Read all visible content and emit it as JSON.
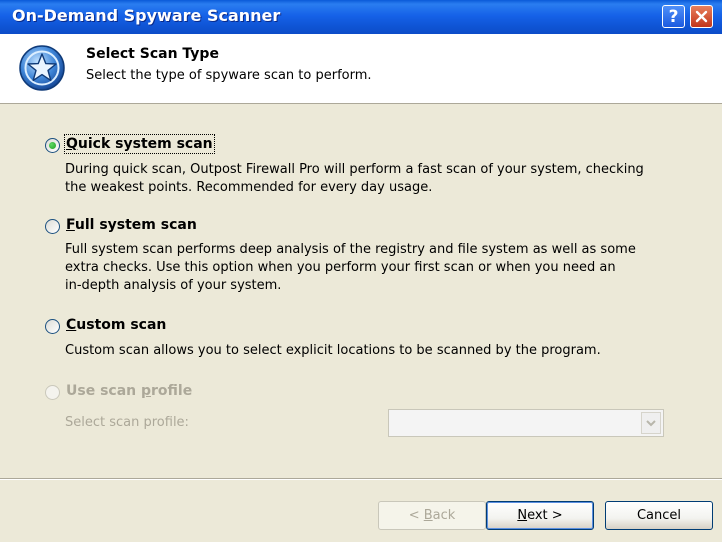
{
  "window": {
    "title": "On-Demand Spyware Scanner",
    "help_label": "?"
  },
  "header": {
    "icon": "shield-star-icon",
    "title": "Select Scan Type",
    "subtitle": "Select the type of spyware scan to perform."
  },
  "options": [
    {
      "key": "Q",
      "label_rest": "uick system scan",
      "checked": true,
      "enabled": true,
      "description_lines": [
        "During quick scan, Outpost Firewall Pro will perform a fast scan of your system, checking",
        "the weakest points. Recommended for every day usage."
      ]
    },
    {
      "key": "F",
      "label_rest": "ull system scan",
      "checked": false,
      "enabled": true,
      "description_lines": [
        "Full system scan performs deep analysis of the registry and file system as well as some",
        "extra checks. Use this option when you perform your first scan or when you need an",
        "in-depth analysis of your system."
      ]
    },
    {
      "key": "C",
      "label_rest": "ustom scan",
      "checked": false,
      "enabled": true,
      "description_lines": [
        "Custom scan allows you to select explicit locations to be scanned by the program."
      ]
    },
    {
      "label_pre": "Use scan ",
      "key": "p",
      "label_rest": "rofile",
      "checked": false,
      "enabled": false
    }
  ],
  "profile": {
    "label": "Select scan profile:",
    "value": ""
  },
  "buttons": {
    "back_arrow": "< ",
    "back_key": "B",
    "back_rest": "ack",
    "next_key": "N",
    "next_rest": "ext >",
    "cancel": "Cancel"
  },
  "colors": {
    "titlebar": "#1662e8",
    "dialog_bg": "#ece9d8",
    "disabled_text": "#aca899"
  }
}
